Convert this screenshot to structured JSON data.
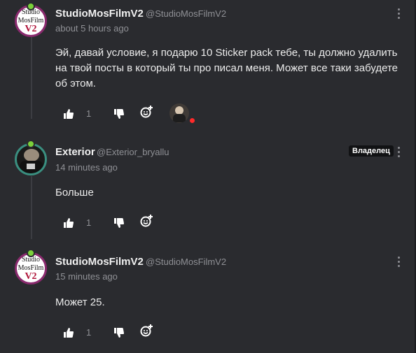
{
  "comments": [
    {
      "author": "StudioMosFilmV2",
      "handle": "@StudioMosFilmV2",
      "time": "about 5 hours ago",
      "text": "Эй, давай условие, я подарю 10 Sticker pack тебе, ты должно удалить на твой посты в который ты про писал меня. Может все таки забудете об этом.",
      "likes": "1",
      "avatar": {
        "line1": "Studio",
        "line2": "MosFilm",
        "line3": "V2"
      }
    },
    {
      "author": "Exterior",
      "handle": "@Exterior_bryallu",
      "time": "14 minutes ago",
      "text": "Больше",
      "likes": "1",
      "badge": "Владелец"
    },
    {
      "author": "StudioMosFilmV2",
      "handle": "@StudioMosFilmV2",
      "time": "15 minutes ago",
      "text": "Может 25.",
      "likes": "1",
      "avatar": {
        "line1": "Studio",
        "line2": "MosFilm",
        "line3": "V2"
      }
    }
  ],
  "colors": {
    "background": "#2a2b2f",
    "muted_text": "#8f9095",
    "online_badge": "#7bd13a",
    "studio_avatar_ring": "#8a2a6e",
    "exterior_avatar_ring": "#3a8f80",
    "reaction_dot": "#ff2a2a"
  },
  "icons": [
    "like-icon",
    "dislike-icon",
    "add-reaction-icon",
    "more-options-icon"
  ]
}
